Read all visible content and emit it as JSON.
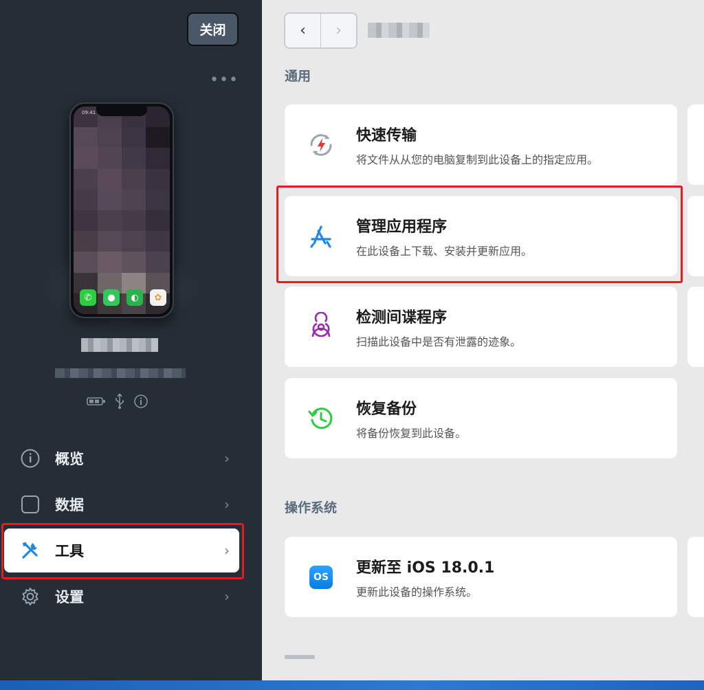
{
  "sidebar": {
    "close_label": "关闭",
    "more_icon": "more-dots-icon",
    "phone_time": "09:41",
    "nav": [
      {
        "label": "概览",
        "icon": "info-icon"
      },
      {
        "label": "数据",
        "icon": "square-icon"
      },
      {
        "label": "工具",
        "icon": "tools-icon",
        "active": true
      },
      {
        "label": "设置",
        "icon": "gear-icon"
      }
    ]
  },
  "main": {
    "sections": [
      {
        "title": "通用",
        "cards": [
          {
            "title": "快速传输",
            "desc": "将文件从从您的电脑复制到此设备上的指定应用。",
            "icon": "fast-transfer-icon"
          },
          {
            "title": "管理应用程序",
            "desc": "在此设备上下载、安装并更新应用。",
            "icon": "app-store-icon"
          },
          {
            "title": "检测间谍程序",
            "desc": "扫描此设备中是否有泄露的迹象。",
            "icon": "biohazard-icon"
          },
          {
            "title": "恢复备份",
            "desc": "将备份恢复到此设备。",
            "icon": "restore-clock-icon"
          }
        ]
      },
      {
        "title": "操作系统",
        "cards": [
          {
            "title": "更新至 iOS 18.0.1",
            "desc": "更新此设备的操作系统。",
            "icon": "os-badge-icon",
            "badge": "OS"
          }
        ]
      }
    ]
  },
  "colors": {
    "sidebar_bg": "#252d36",
    "main_bg": "#e9e9ea",
    "highlight": "#e02020",
    "accent_blue": "#1e88e5"
  }
}
